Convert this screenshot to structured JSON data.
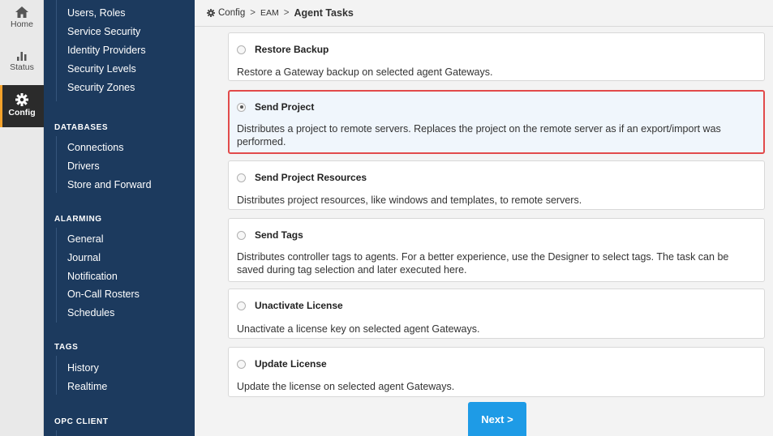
{
  "rail": {
    "items": [
      {
        "label": "Home",
        "icon": "home-icon"
      },
      {
        "label": "Status",
        "icon": "bar-chart-icon"
      },
      {
        "label": "Config",
        "icon": "gear-icon",
        "active": true
      }
    ]
  },
  "nav": {
    "top_items": [
      "Users, Roles",
      "Service Security",
      "Identity Providers",
      "Security Levels",
      "Security Zones"
    ],
    "sections": [
      {
        "heading": "DATABASES",
        "items": [
          "Connections",
          "Drivers",
          "Store and Forward"
        ]
      },
      {
        "heading": "ALARMING",
        "items": [
          "General",
          "Journal",
          "Notification",
          "On-Call Rosters",
          "Schedules"
        ]
      },
      {
        "heading": "TAGS",
        "items": [
          "History",
          "Realtime"
        ]
      },
      {
        "heading": "OPC CLIENT",
        "items": []
      }
    ]
  },
  "breadcrumb": {
    "root": "Config",
    "middle": "EAM",
    "current": "Agent Tasks",
    "separator": ">"
  },
  "tasks": [
    {
      "title": "Restore Backup",
      "description": "Restore a Gateway backup on selected agent Gateways.",
      "selected": false
    },
    {
      "title": "Send Project",
      "description": "Distributes a project to remote servers. Replaces the project on the remote server as if an export/import was performed.",
      "selected": true
    },
    {
      "title": "Send Project Resources",
      "description": "Distributes project resources, like windows and templates, to remote servers.",
      "selected": false
    },
    {
      "title": "Send Tags",
      "description": "Distributes controller tags to agents. For a better experience, use the Designer to select tags. The task can be saved during tag selection and later executed here.",
      "selected": false
    },
    {
      "title": "Unactivate License",
      "description": "Unactivate a license key on selected agent Gateways.",
      "selected": false
    },
    {
      "title": "Update License",
      "description": "Update the license on selected agent Gateways.",
      "selected": false
    }
  ],
  "next_label": "Next >",
  "colors": {
    "sidebar": "#1c3a5e",
    "accent": "#f4a22b",
    "selected_border": "#e24a4a",
    "primary_button": "#1e9be6"
  }
}
